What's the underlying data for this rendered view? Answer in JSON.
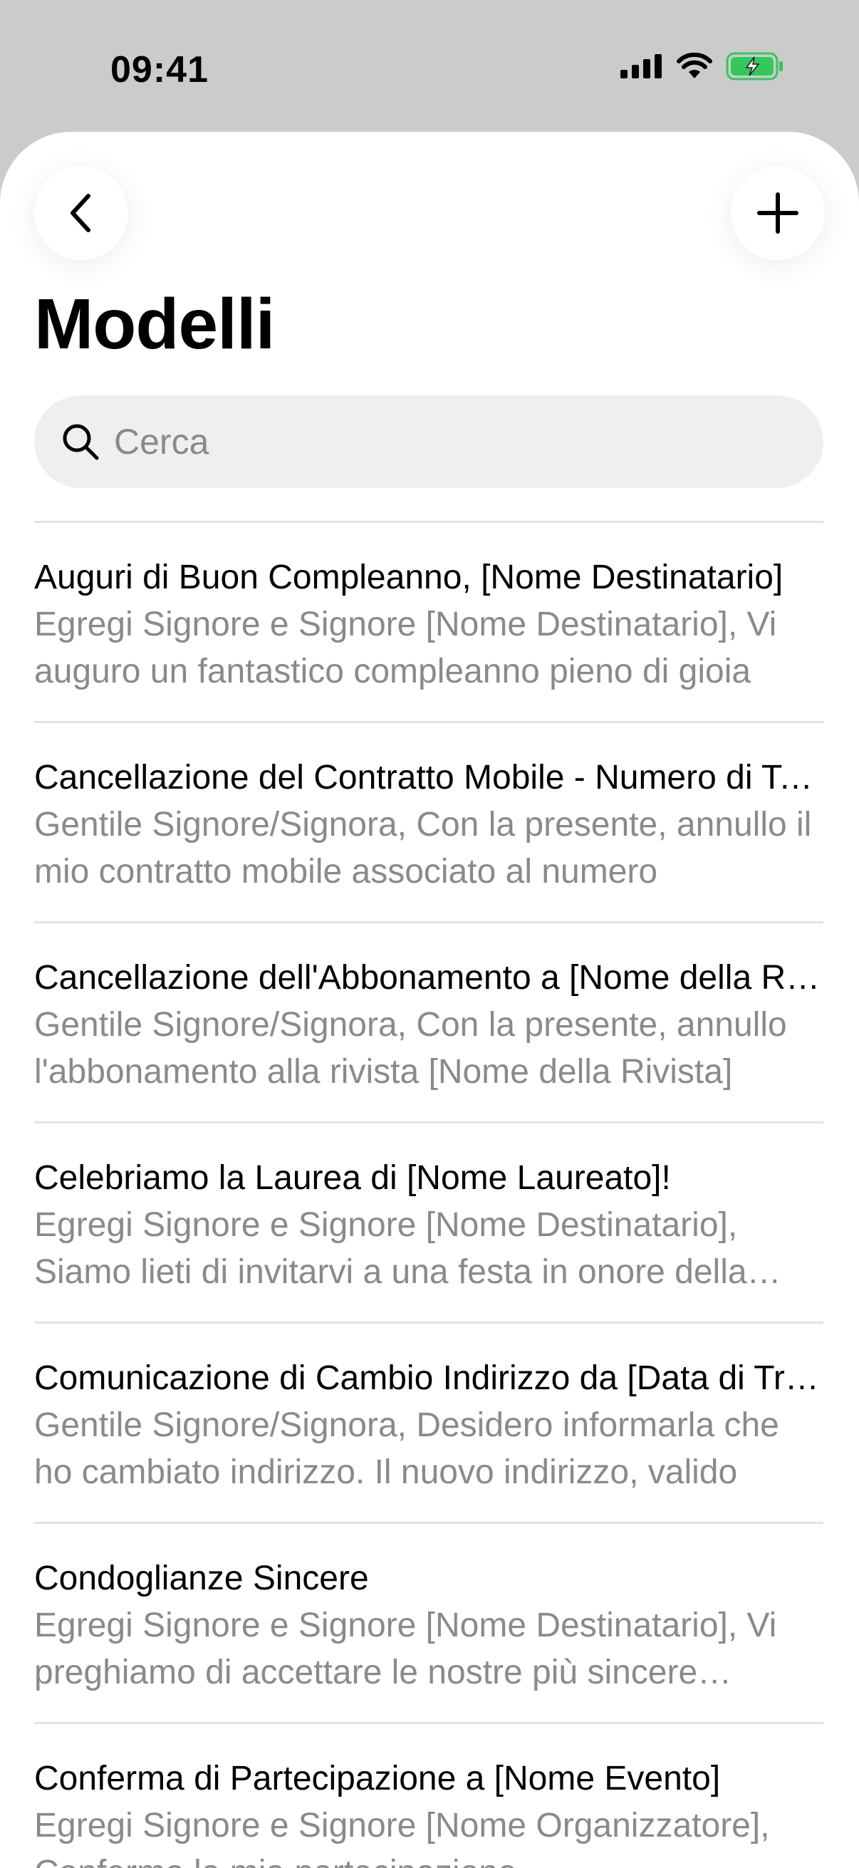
{
  "status_bar": {
    "time": "09:41",
    "battery_color": "#34c759"
  },
  "header": {
    "title": "Modelli",
    "back_icon": "chevron-left-icon",
    "add_icon": "plus-icon"
  },
  "search": {
    "placeholder": "Cerca",
    "value": ""
  },
  "templates": [
    {
      "title": "Auguri di Buon Compleanno, [Nome Destinatario]",
      "preview": "Egregi Signore e Signore [Nome Destinatario], Vi auguro un fantastico compleanno pieno di gioia"
    },
    {
      "title": "Cancellazione del Contratto Mobile - Numero di Telefono",
      "preview": "Gentile Signore/Signora,  Con la presente, annullo il mio contratto mobile associato al numero"
    },
    {
      "title": "Cancellazione dell'Abbonamento a [Nome della Rivista]",
      "preview": "Gentile Signore/Signora,  Con la presente, annullo l'abbonamento alla rivista [Nome della Rivista]"
    },
    {
      "title": "Celebriamo la Laurea di [Nome Laureato]!",
      "preview": "Egregi Signore e Signore [Nome Destinatario], Siamo lieti di invitarvi a una festa in onore della laurea"
    },
    {
      "title": "Comunicazione di Cambio Indirizzo da [Data di Trasloco]",
      "preview": "Gentile Signore/Signora,  Desidero informarla che ho cambiato indirizzo. Il nuovo indirizzo, valido"
    },
    {
      "title": "Condoglianze Sincere",
      "preview": "Egregi Signore e Signore [Nome Destinatario], Vi preghiamo di accettare le nostre più sincere condoglianze"
    },
    {
      "title": "Conferma di Partecipazione a [Nome Evento]",
      "preview": "Egregi Signore e Signore [Nome Organizzatore], Confermo la mia partecipazione"
    }
  ]
}
